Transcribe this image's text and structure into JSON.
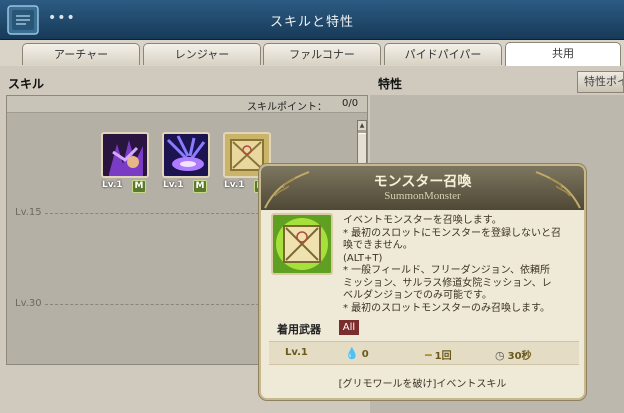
{
  "window": {
    "title": "スキルと特性",
    "menu_glyph": "•••"
  },
  "tabs": [
    {
      "label": "アーチャー",
      "active": false
    },
    {
      "label": "レンジャー",
      "active": false
    },
    {
      "label": "ファルコナー",
      "active": false
    },
    {
      "label": "パイドパイパー",
      "active": false
    },
    {
      "label": "共用",
      "active": true
    }
  ],
  "skill_section": {
    "title": "スキル",
    "points_label": "スキルポイント：",
    "points_value": "0/0",
    "level_markers": [
      "Lv.15",
      "Lv.30"
    ],
    "slots": [
      {
        "level": "Lv.1",
        "badge": "M",
        "icon": "dark-claw-skill-icon"
      },
      {
        "level": "Lv.1",
        "badge": "M",
        "icon": "purple-burst-skill-icon"
      },
      {
        "level": "Lv.1",
        "badge": "M",
        "icon": "summon-scroll-skill-icon"
      }
    ]
  },
  "trait_section": {
    "title": "特性",
    "tab_label": "特性ポイ"
  },
  "tooltip": {
    "title": "モンスター召喚",
    "subtitle": "SummonMonster",
    "description_lines": [
      "イベントモンスターを召喚します。",
      "* 最初のスロットにモンスターを登録しないと召",
      "喚できません。",
      "(ALT+T)",
      "* 一般フィールド、フリーダンジョン、依頼所",
      "ミッション、サルラス修道女院ミッション、レ",
      "ベルダンジョンでのみ可能です。",
      "* 最初のスロットモンスターのみ召喚します。"
    ],
    "weapon_label": "着用武器",
    "weapon_value": "All",
    "stats": {
      "level": "Lv.1",
      "sp": "0",
      "uses": "1回",
      "cooldown": "30秒"
    },
    "footer": "[グリモワールを破け]イベントスキル"
  }
}
